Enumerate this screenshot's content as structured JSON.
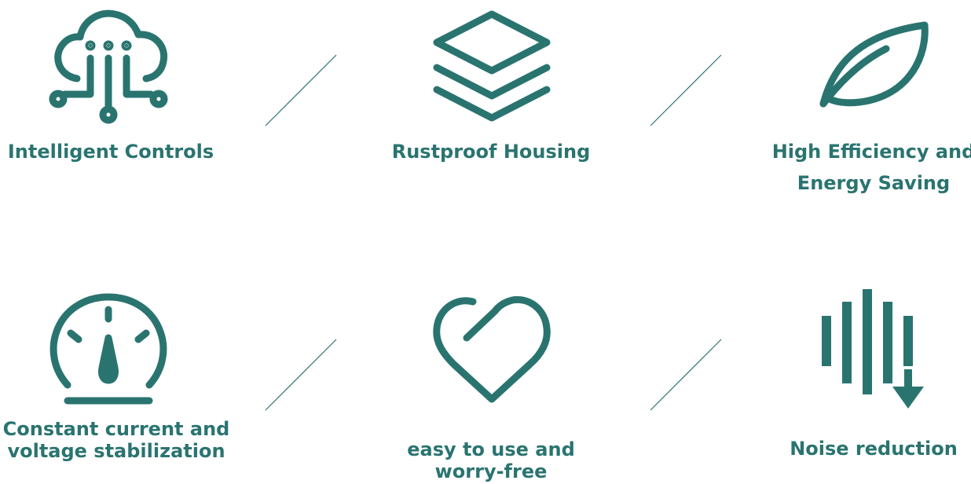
{
  "colors": {
    "icon": "#2a7470",
    "text": "#2a7470",
    "divider": "#2a7470"
  },
  "features": [
    {
      "icon": "cloud-circuit-icon",
      "label_line1": "Intelligent Controls",
      "label_line2": ""
    },
    {
      "icon": "layers-icon",
      "label_line1": "Rustproof Housing",
      "label_line2": ""
    },
    {
      "icon": "leaf-icon",
      "label_line1": "High Efficiency and",
      "label_line2": "Energy Saving"
    },
    {
      "icon": "gauge-icon",
      "label_line1": "Constant current and",
      "label_line2": "voltage stabilization"
    },
    {
      "icon": "heart-icon",
      "label_line1": "easy to use and",
      "label_line2": "worry-free"
    },
    {
      "icon": "sound-bars-down-icon",
      "label_line1": "Noise reduction",
      "label_line2": ""
    }
  ]
}
